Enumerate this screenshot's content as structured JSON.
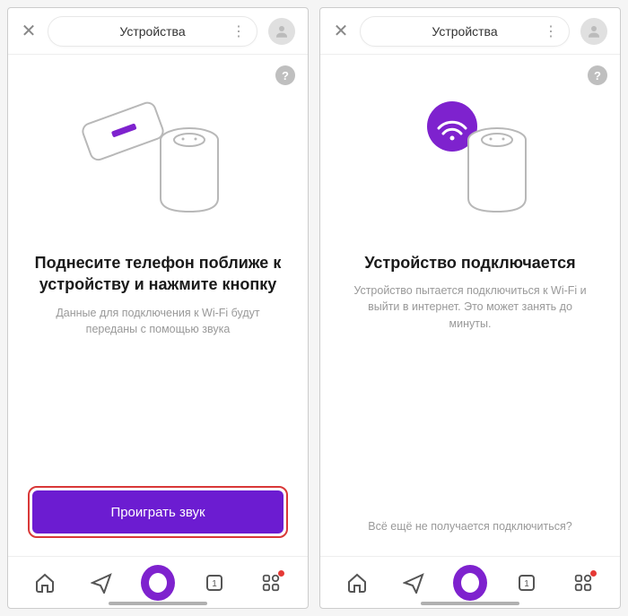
{
  "screens": [
    {
      "header": {
        "title": "Устройства"
      },
      "heading": "Поднесите телефон поближе к устройству и нажмите кнопку",
      "subtext": "Данные для подключения к Wi-Fi будут переданы с помощью звука",
      "cta": "Проиграть звук",
      "help_link": ""
    },
    {
      "header": {
        "title": "Устройства"
      },
      "heading": "Устройство подключается",
      "subtext": "Устройство пытается подключиться к Wi-Fi и выйти в интернет. Это может занять до минуты.",
      "cta": "",
      "help_link": "Всё ещё не получается подключиться?"
    }
  ],
  "nav": {
    "counter": "1"
  },
  "colors": {
    "accent": "#7e22ce",
    "cta": "#6c1cd1",
    "highlight": "#d93838"
  }
}
